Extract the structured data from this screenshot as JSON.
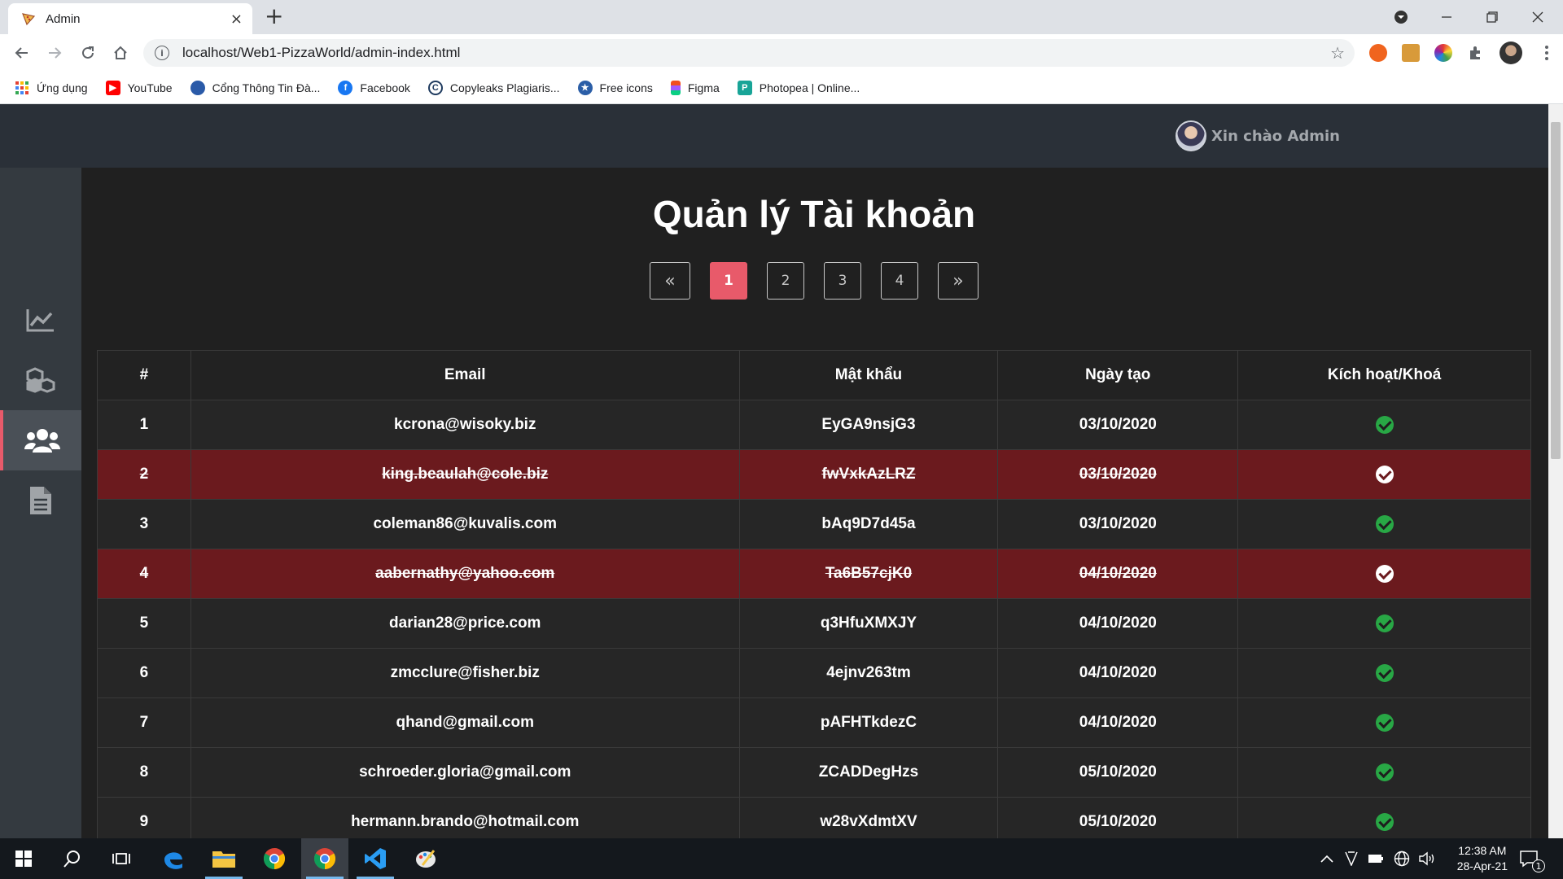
{
  "browser": {
    "tab_title": "Admin",
    "tab_close": "×",
    "new_tab": "+",
    "url": "localhost/Web1-PizzaWorld/admin-index.html",
    "bookmarks": [
      {
        "label": "Ứng dụng",
        "icon": "apps-grid-icon",
        "color": "#e34234"
      },
      {
        "label": "YouTube",
        "icon": "youtube-icon",
        "color": "#ff0000"
      },
      {
        "label": "Cổng Thông Tin Đà...",
        "icon": "portal-icon",
        "color": "#2a5aa8"
      },
      {
        "label": "Facebook",
        "icon": "facebook-icon",
        "color": "#1877f2"
      },
      {
        "label": "Copyleaks Plagiaris...",
        "icon": "copyleaks-icon",
        "color": "#1e3a5f"
      },
      {
        "label": "Free icons",
        "icon": "free-icons-icon",
        "color": "#2b5ea7"
      },
      {
        "label": "Figma",
        "icon": "figma-icon",
        "color": "#f24e1e"
      },
      {
        "label": "Photopea | Online...",
        "icon": "photopea-icon",
        "color": "#18a497"
      }
    ]
  },
  "header": {
    "greeting": "Xin chào Admin"
  },
  "sidebar": {
    "items": [
      {
        "icon": "chart-line-icon",
        "active": false
      },
      {
        "icon": "boxes-icon",
        "active": false
      },
      {
        "icon": "users-icon",
        "active": true
      },
      {
        "icon": "document-icon",
        "active": false
      }
    ]
  },
  "page": {
    "title": "Quản lý Tài khoản"
  },
  "pagination": {
    "prev": "«",
    "next": "»",
    "pages": [
      "1",
      "2",
      "3",
      "4"
    ],
    "current": "1"
  },
  "table": {
    "headers": [
      "#",
      "Email",
      "Mật khẩu",
      "Ngày tạo",
      "Kích hoạt/Khoá"
    ],
    "rows": [
      {
        "id": "1",
        "email": "kcrona@wisoky.biz",
        "password": "EyGA9nsjG3",
        "created": "03/10/2020",
        "locked": false
      },
      {
        "id": "2",
        "email": "king.beaulah@cole.biz",
        "password": "fwVxkAzLRZ",
        "created": "03/10/2020",
        "locked": true
      },
      {
        "id": "3",
        "email": "coleman86@kuvalis.com",
        "password": "bAq9D7d45a",
        "created": "03/10/2020",
        "locked": false
      },
      {
        "id": "4",
        "email": "aabernathy@yahoo.com",
        "password": "Ta6B57cjK0",
        "created": "04/10/2020",
        "locked": true
      },
      {
        "id": "5",
        "email": "darian28@price.com",
        "password": "q3HfuXMXJY",
        "created": "04/10/2020",
        "locked": false
      },
      {
        "id": "6",
        "email": "zmcclure@fisher.biz",
        "password": "4ejnv263tm",
        "created": "04/10/2020",
        "locked": false
      },
      {
        "id": "7",
        "email": "qhand@gmail.com",
        "password": "pAFHTkdezC",
        "created": "04/10/2020",
        "locked": false
      },
      {
        "id": "8",
        "email": "schroeder.gloria@gmail.com",
        "password": "ZCADDegHzs",
        "created": "05/10/2020",
        "locked": false
      },
      {
        "id": "9",
        "email": "hermann.brando@hotmail.com",
        "password": "w28vXdmtXV",
        "created": "05/10/2020",
        "locked": false
      }
    ]
  },
  "taskbar": {
    "time": "12:38 AM",
    "date": "28-Apr-21",
    "notifications": "1"
  },
  "colors": {
    "accent": "#e85a6a",
    "active_status": "#28a745",
    "locked_row": "#6b1a1e"
  }
}
